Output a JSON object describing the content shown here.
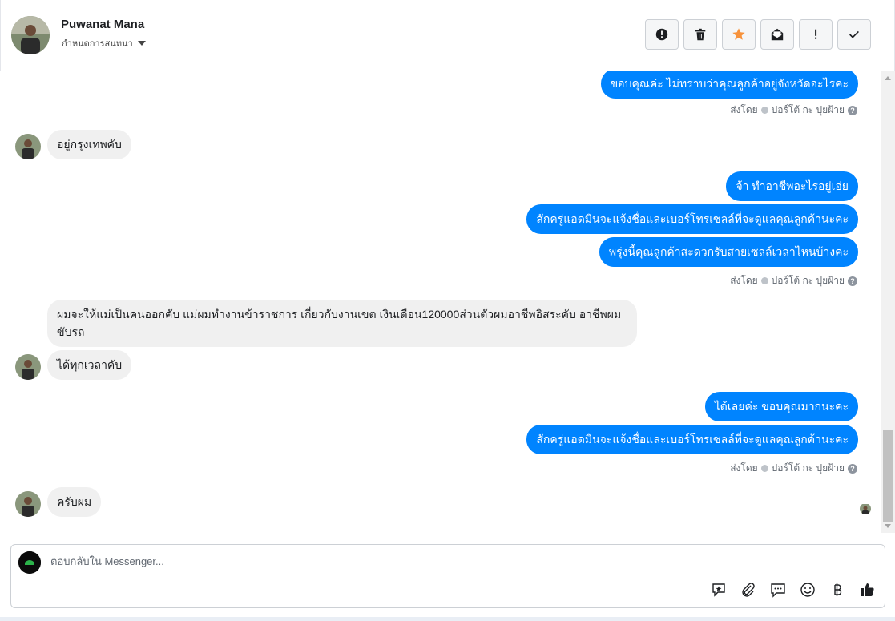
{
  "header": {
    "contact_name": "Puwanat Mana",
    "subtitle": "กำหนดการสนทนา",
    "actions": [
      {
        "name": "spam-button",
        "icon": "alert-circle-icon"
      },
      {
        "name": "delete-button",
        "icon": "trash-icon"
      },
      {
        "name": "star-button",
        "icon": "star-icon"
      },
      {
        "name": "mark-unread-button",
        "icon": "envelope-open-icon"
      },
      {
        "name": "important-button",
        "icon": "exclamation-icon"
      },
      {
        "name": "done-button",
        "icon": "check-icon"
      }
    ],
    "star_color": "#f7923b"
  },
  "conversation": {
    "outgoing_color": "#0084ff",
    "messages": [
      {
        "dir": "out",
        "text": "ขอบคุณค่ะ ไม่ทราบว่าคุณลูกค้าอยู่จังหวัดอะไรคะ"
      },
      {
        "sent_by": "ส่งโดย",
        "agent": "ปอร์โต้ กะ ปุยฝ้าย"
      },
      {
        "dir": "in",
        "text": "อยู่กรุงเทพคับ"
      },
      {
        "dir": "out",
        "text": "จ้า ทำอาชีพอะไรอยู่เอ่ย"
      },
      {
        "dir": "out",
        "text": "สักครู่แอดมินจะแจ้งชื่อและเบอร์โทรเซลล์ที่จะดูแลคุณลูกค้านะคะ"
      },
      {
        "dir": "out",
        "text": "พรุ่งนี้คุณลูกค้าสะดวกรับสายเซลล์เวลาไหนบ้างคะ"
      },
      {
        "sent_by": "ส่งโดย",
        "agent": "ปอร์โต้ กะ ปุยฝ้าย"
      },
      {
        "dir": "in",
        "text": "ผมจะให้แม่เป็นคนออกคับ แม่ผมทำงานข้าราชการ เกี่ยวกับงานเขต เงินเดือน120000ส่วนตัวผมอาชีพอิสระคับ อาชีพผมขับรถ"
      },
      {
        "dir": "in",
        "text": "ได้ทุกเวลาคับ"
      },
      {
        "dir": "out",
        "text": "ได้เลยค่ะ ขอบคุณมากนะคะ"
      },
      {
        "dir": "out",
        "text": "สักครู่แอดมินจะแจ้งชื่อและเบอร์โทรเซลล์ที่จะดูแลคุณลูกค้านะคะ"
      },
      {
        "sent_by": "ส่งโดย",
        "agent": "ปอร์โต้ กะ ปุยฝ้าย"
      },
      {
        "dir": "in",
        "text": "ครับผม"
      }
    ]
  },
  "composer": {
    "placeholder": "ตอบกลับใน Messenger...",
    "icons": [
      "saved-reply-icon",
      "attachment-icon",
      "chat-bubble-icon",
      "emoji-icon",
      "baht-payment-icon",
      "thumbs-up-icon"
    ]
  }
}
